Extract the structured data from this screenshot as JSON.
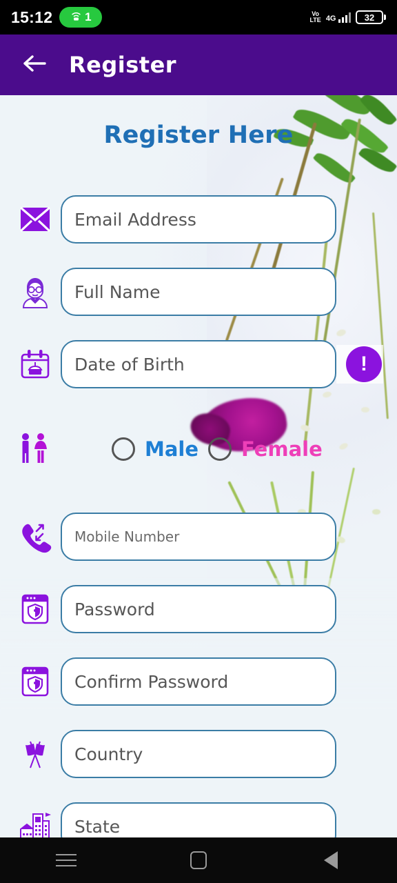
{
  "status_bar": {
    "time": "15:12",
    "hotspot_icon": "hotspot-icon",
    "hotspot_count": "1",
    "volte_top": "Vo",
    "volte_bottom": "LTE",
    "network": "4G",
    "battery_level": "32"
  },
  "app_bar": {
    "back_icon": "back-arrow-icon",
    "title": "Register",
    "background_color": "#4B0C8C"
  },
  "page": {
    "title": "Register Here",
    "title_color": "#1F6FB5",
    "background_color": "#EEF4F8",
    "field_border_color": "#3A7CA5",
    "icon_color": "#8B13DE"
  },
  "fields": [
    {
      "name": "email",
      "icon": "envelope-icon",
      "placeholder": "Email Address",
      "value": "",
      "has_error": false
    },
    {
      "name": "full-name",
      "icon": "person-icon",
      "placeholder": "Full Name",
      "value": "",
      "has_error": false
    },
    {
      "name": "date-of-birth",
      "icon": "calendar-cake-icon",
      "placeholder": "Date of Birth",
      "value": "",
      "has_error": true,
      "error_mark": "!"
    },
    {
      "name": "mobile-number",
      "icon": "phone-icon",
      "placeholder": "Mobile Number",
      "value": "",
      "has_error": false
    },
    {
      "name": "password",
      "icon": "shield-window-icon",
      "placeholder": "Password",
      "value": "",
      "has_error": false
    },
    {
      "name": "confirm-password",
      "icon": "shield-window-icon",
      "placeholder": "Confirm Password",
      "value": "",
      "has_error": false
    },
    {
      "name": "country",
      "icon": "crossed-flags-icon",
      "placeholder": "Country",
      "value": "",
      "has_error": false
    },
    {
      "name": "state",
      "icon": "city-buildings-icon",
      "placeholder": "State",
      "value": "",
      "has_error": false
    }
  ],
  "gender": {
    "icon": "male-female-icon",
    "options": [
      {
        "label": "Male",
        "selected": false,
        "color": "#1E7FD4"
      },
      {
        "label": "Female",
        "selected": false,
        "color": "#EE3FB8"
      }
    ]
  },
  "nav_bar": {
    "recents_icon": "recent-apps-icon",
    "home_icon": "home-icon",
    "back_icon": "back-nav-icon"
  }
}
